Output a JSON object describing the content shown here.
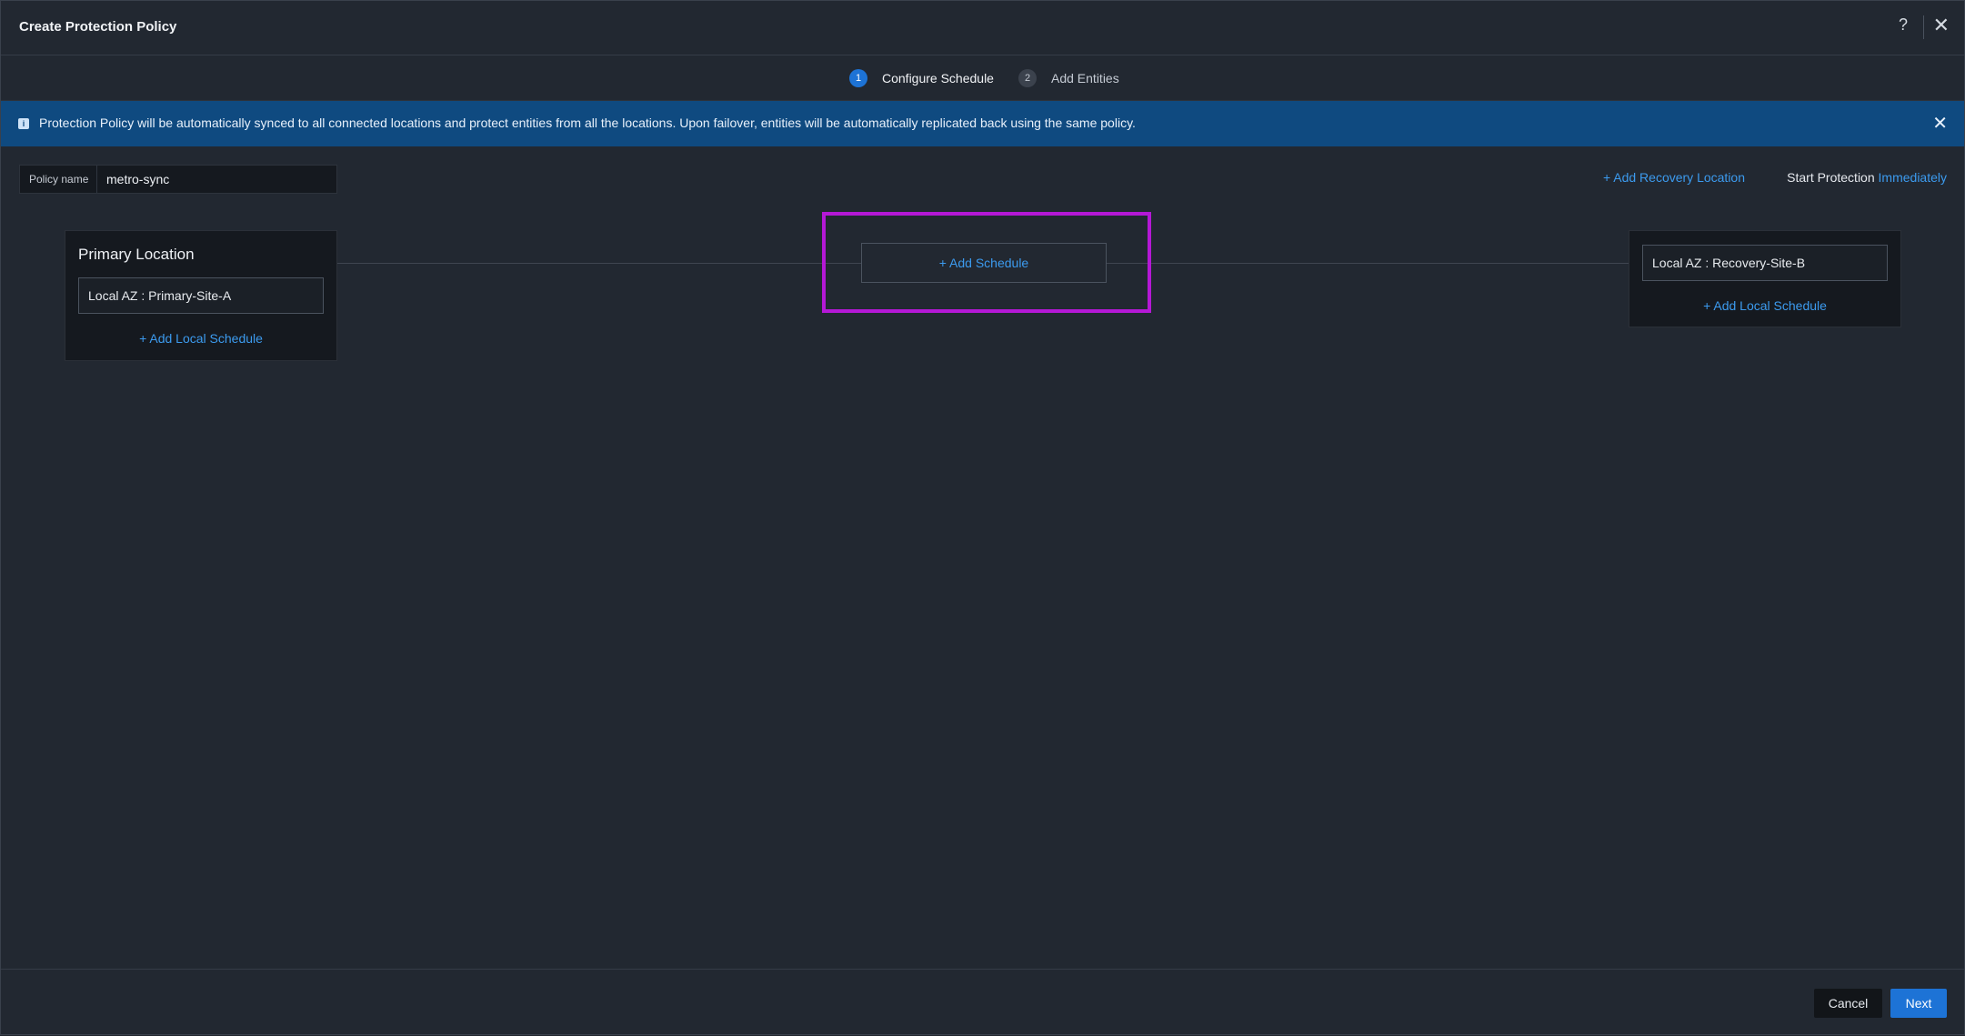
{
  "dialog": {
    "title": "Create Protection Policy",
    "help_label": "?",
    "close_label": "✕"
  },
  "stepper": {
    "steps": [
      {
        "number": "1",
        "label": "Configure Schedule",
        "active": true
      },
      {
        "number": "2",
        "label": "Add Entities",
        "active": false
      }
    ]
  },
  "banner": {
    "icon": "info-icon",
    "message": "Protection Policy will be automatically synced to all connected locations and protect entities from all the locations. Upon failover, entities will be automatically replicated back using the same policy.",
    "close_label": "✕"
  },
  "policy": {
    "label": "Policy name",
    "value": "metro-sync"
  },
  "top_actions": {
    "add_recovery": "+ Add Recovery Location",
    "start_protection": "Start Protection",
    "start_protection_value": "Immediately"
  },
  "primary": {
    "title": "Primary Location",
    "location": "Local AZ : Primary-Site-A",
    "add_local": "+   Add Local Schedule"
  },
  "schedule": {
    "add_label": "+ Add Schedule"
  },
  "recovery": {
    "location": "Local AZ : Recovery-Site-B",
    "add_local": "+   Add Local Schedule"
  },
  "footer": {
    "cancel": "Cancel",
    "next": "Next"
  },
  "colors": {
    "accent": "#1d73d6",
    "link": "#3c9bef",
    "highlight": "#b518d6",
    "banner": "#0f4a80"
  }
}
